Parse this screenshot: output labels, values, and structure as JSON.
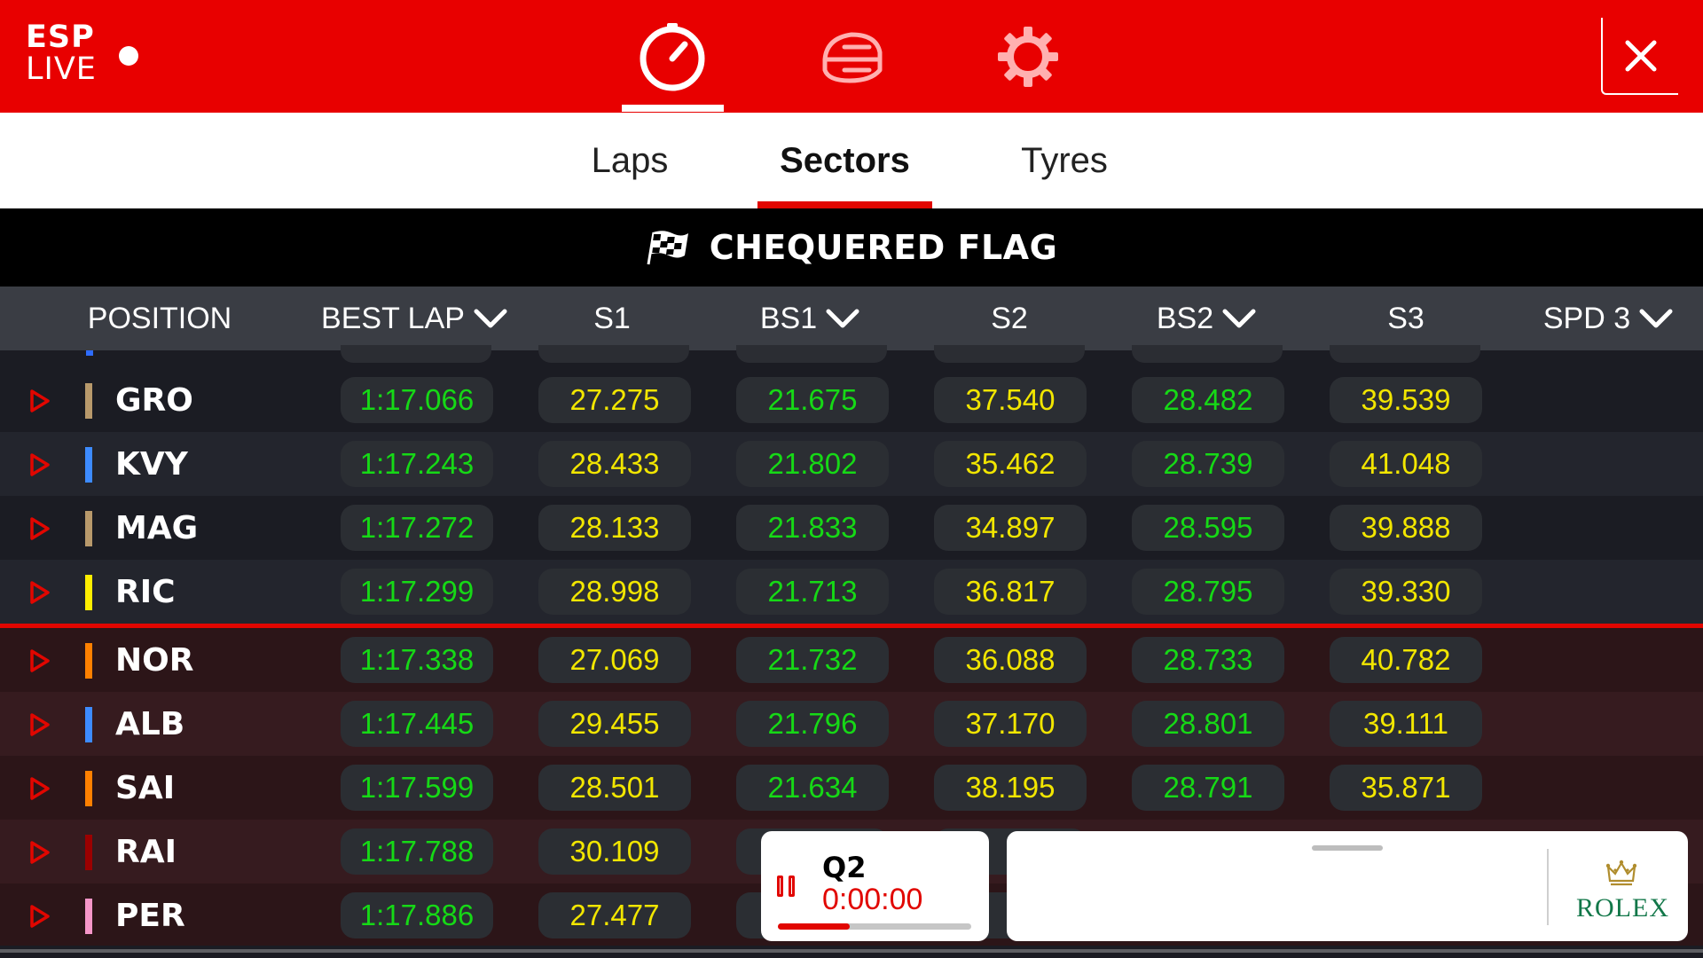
{
  "header": {
    "logo_top": "ESP",
    "logo_bottom": "LIVE",
    "nav_icons": [
      "timer-icon",
      "car-icon",
      "gear-icon"
    ],
    "active_nav": "timer-icon",
    "close_icon": "close-icon",
    "accent_color": "#e80000"
  },
  "tabs": {
    "items": [
      "Laps",
      "Sectors",
      "Tyres"
    ],
    "active": "Sectors"
  },
  "banner": {
    "flag_icon": "chequered-flag-icon",
    "text": "CHEQUERED FLAG"
  },
  "columns": [
    {
      "label": "POSITION",
      "sortable": false
    },
    {
      "label": "BEST LAP",
      "sortable": true
    },
    {
      "label": "S1",
      "sortable": false
    },
    {
      "label": "BS1",
      "sortable": true
    },
    {
      "label": "S2",
      "sortable": false
    },
    {
      "label": "BS2",
      "sortable": true
    },
    {
      "label": "S3",
      "sortable": false
    },
    {
      "label": "SPD 3",
      "sortable": true
    }
  ],
  "rows": [
    {
      "driver": "GRO",
      "team_color": "#b8996b",
      "best_lap": "1:17.066",
      "s1": "27.275",
      "bs1": "21.675",
      "s2": "37.540",
      "bs2": "28.482",
      "s3": "39.539"
    },
    {
      "driver": "KVY",
      "team_color": "#3d8bff",
      "best_lap": "1:17.243",
      "s1": "28.433",
      "bs1": "21.802",
      "s2": "35.462",
      "bs2": "28.739",
      "s3": "41.048"
    },
    {
      "driver": "MAG",
      "team_color": "#b8996b",
      "best_lap": "1:17.272",
      "s1": "28.133",
      "bs1": "21.833",
      "s2": "34.897",
      "bs2": "28.595",
      "s3": "39.888"
    },
    {
      "driver": "RIC",
      "team_color": "#ffee00",
      "best_lap": "1:17.299",
      "s1": "28.998",
      "bs1": "21.713",
      "s2": "36.817",
      "bs2": "28.795",
      "s3": "39.330"
    },
    {
      "driver": "NOR",
      "team_color": "#ff8000",
      "best_lap": "1:17.338",
      "s1": "27.069",
      "bs1": "21.732",
      "s2": "36.088",
      "bs2": "28.733",
      "s3": "40.782"
    },
    {
      "driver": "ALB",
      "team_color": "#3d8bff",
      "best_lap": "1:17.445",
      "s1": "29.455",
      "bs1": "21.796",
      "s2": "37.170",
      "bs2": "28.801",
      "s3": "39.111"
    },
    {
      "driver": "SAI",
      "team_color": "#ff8000",
      "best_lap": "1:17.599",
      "s1": "28.501",
      "bs1": "21.634",
      "s2": "38.195",
      "bs2": "28.791",
      "s3": "35.871"
    },
    {
      "driver": "RAI",
      "team_color": "#9b0000",
      "best_lap": "1:17.788",
      "s1": "30.109",
      "bs1": "",
      "s2": "",
      "bs2": "",
      "s3": ""
    },
    {
      "driver": "PER",
      "team_color": "#f596c8",
      "best_lap": "1:17.886",
      "s1": "27.477",
      "bs1": "",
      "s2": "",
      "bs2": "",
      "s3": ""
    }
  ],
  "session": {
    "name": "Q2",
    "clock": "0:00:00",
    "status_icon": "pause-icon",
    "progress_fraction": 0.37
  },
  "sponsor": {
    "brand": "ROLEX",
    "crown_icon": "crown-icon",
    "brand_color": "#127749"
  }
}
